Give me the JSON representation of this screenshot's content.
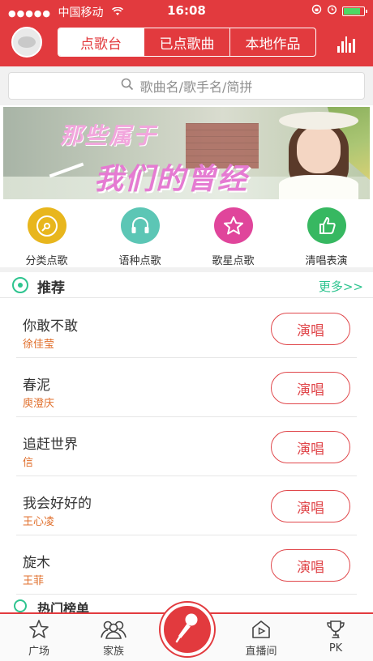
{
  "status": {
    "carrier": "中国移动",
    "time": "16:08",
    "battery_level": 0.85
  },
  "header": {
    "tabs": [
      {
        "label": "点歌台",
        "active": true
      },
      {
        "label": "已点歌曲",
        "active": false
      },
      {
        "label": "本地作品",
        "active": false
      }
    ]
  },
  "search": {
    "placeholder": "歌曲名/歌手名/简拼"
  },
  "banner": {
    "line1": "那些属于",
    "line2": "我们的曾经"
  },
  "categories": [
    {
      "label": "分类点歌",
      "icon": "disc-icon",
      "color": "#e8b61d"
    },
    {
      "label": "语种点歌",
      "icon": "headphones-icon",
      "color": "#5cc6b5"
    },
    {
      "label": "歌星点歌",
      "icon": "star-icon",
      "color": "#e0459b"
    },
    {
      "label": "清唱表演",
      "icon": "thumbs-up-icon",
      "color": "#37b861"
    }
  ],
  "recommend": {
    "title": "推荐",
    "more": "更多>>"
  },
  "songs": [
    {
      "name": "你敢不敢",
      "artist": "徐佳莹",
      "action": "演唱"
    },
    {
      "name": "春泥",
      "artist": "庾澄庆",
      "action": "演唱"
    },
    {
      "name": "追赶世界",
      "artist": "信",
      "action": "演唱"
    },
    {
      "name": "我会好好的",
      "artist": "王心凌",
      "action": "演唱"
    },
    {
      "name": "旋木",
      "artist": "王菲",
      "action": "演唱"
    }
  ],
  "hot_chart": {
    "title": "热门榜单"
  },
  "tabbar": {
    "items": [
      {
        "label": "广场",
        "icon": "star-outline-icon"
      },
      {
        "label": "家族",
        "icon": "family-icon"
      },
      {
        "label": "",
        "icon": "microphone-icon"
      },
      {
        "label": "直播间",
        "icon": "live-room-icon"
      },
      {
        "label": "PK",
        "icon": "trophy-icon"
      }
    ]
  },
  "colors": {
    "brand_red": "#e23a3e",
    "accent_green": "#2ec48f",
    "artist_orange": "#e06e2a"
  }
}
